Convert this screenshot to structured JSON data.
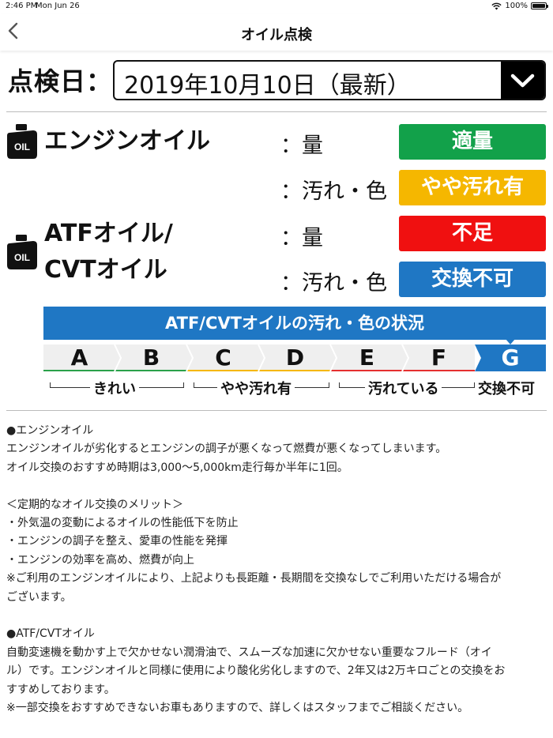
{
  "status_bar": {
    "time": "2:46 PM",
    "date": "Mon Jun 26",
    "battery": "100%"
  },
  "nav": {
    "title": "オイル点検",
    "back_icon": "chevron-left-icon"
  },
  "inspection": {
    "date_label": "点検日：",
    "selected_date": "2019年10月10日（最新）",
    "dropdown_icon": "chevron-down-icon"
  },
  "engine_oil": {
    "name": "エンジンオイル",
    "icon": "oil-can-icon",
    "rows": [
      {
        "label": "：量",
        "status": "適量",
        "color": "#12a14a"
      },
      {
        "label": "：汚れ・色",
        "status": "やや汚れ有",
        "color": "#f5b700"
      }
    ]
  },
  "atf_oil": {
    "name_line1": "ATFオイル/",
    "name_line2": "CVTオイル",
    "icon": "oil-can-icon",
    "rows": [
      {
        "label": "：量",
        "status": "不足",
        "color": "#f01010"
      },
      {
        "label": "：汚れ・色",
        "status": "交換不可",
        "color": "#1f77c4"
      }
    ]
  },
  "scale": {
    "title": "ATF/CVTオイルの汚れ・色の状況",
    "grades": [
      "A",
      "B",
      "C",
      "D",
      "E",
      "F",
      "G"
    ],
    "grade_colors": [
      "#2aa14a",
      "#2aa14a",
      "#f5b700",
      "#f5b700",
      "#e53030",
      "#e53030",
      "#1f77c4"
    ],
    "selected": "G",
    "categories": [
      "きれい",
      "やや汚れ有",
      "汚れている",
      "交換不可"
    ]
  },
  "notes": {
    "engine_heading": "●エンジンオイル",
    "engine_p1": "エンジンオイルが劣化するとエンジンの調子が悪くなって燃費が悪くなってしまいます。",
    "engine_p2": "オイル交換のおすすめ時期は3,000〜5,000km走行毎か半年に1回。",
    "merit_heading": "＜定期的なオイル交換のメリット＞",
    "merit_1": "・外気温の変動によるオイルの性能低下を防止",
    "merit_2": "・エンジンの調子を整え、愛車の性能を発揮",
    "merit_3": "・エンジンの効率を高め、燃費が向上",
    "merit_note_1": "※ご利用のエンジンオイルにより、上記よりも長距離・長期間を交換なしでご利用いただける場合が",
    "merit_note_2": "ございます。",
    "atf_heading": "●ATF/CVTオイル",
    "atf_p1": "自動変速機を動かす上で欠かせない潤滑油で、スムーズな加速に欠かせない重要なフルード（オイ",
    "atf_p2": "ル）です。エンジンオイルと同様に使用により酸化劣化しますので、2年又は2万キロごとの交換をお",
    "atf_p3": "すすめしております。",
    "atf_note": "※一部交換をおすすめできないお車もありますので、詳しくはスタッフまでご相談ください。"
  }
}
